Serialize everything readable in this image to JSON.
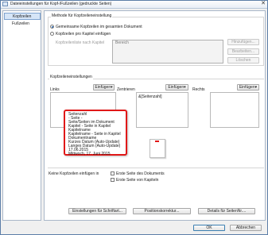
{
  "window": {
    "title": "Dateieinstellungen für Kopf-/Fußzeilen (gedruckte Seiten)",
    "close_glyph": "✕",
    "icon": "app-icon"
  },
  "sidebar": {
    "items": [
      {
        "label": "Kopfzeilen",
        "active": true
      },
      {
        "label": "Fußzeilen",
        "active": false
      }
    ]
  },
  "method": {
    "group_label": "Methode für Kopfzeileneinstellung",
    "option_document": "Gemeinsame Kopfzeilen im gesamten Dokument",
    "option_chapter": "Kopfzeilen pro Kapitel einfügen",
    "chapter_list_label": "Kopfzeilenliste nach Kapitel",
    "range_placeholder": "Bereich",
    "add_button": "Hinzufügen...",
    "edit_button": "Bearbeiten...",
    "delete_button": "Löschen"
  },
  "header_settings": {
    "group_label": "Kopfzeileneinstellungen",
    "left_label": "Links",
    "center_label": "Zentrieren",
    "right_label": "Rechts",
    "insert_button": "Einfügen",
    "dropdown_glyph": "▾",
    "center_value": "&[Seitenzahl]"
  },
  "insert_menu": {
    "items": [
      "Seitenzahl",
      "- Seite -",
      "Seite/Seiten im Dokument",
      "Kapitel - Seite in Kapitel",
      "Kapitelname",
      "Kapitelname - Seite in Kapitel",
      "Dokumentname",
      "Kurzes Datum (Auto-Update)",
      "Langes Datum (Auto-Update)",
      "17.06.2015",
      "Mittwoch, 17. Juni 2015"
    ]
  },
  "exclude": {
    "label": "Keine Kopfzeilen einfügen in",
    "first_doc_page": "Erste Seite des Dokuments",
    "first_chapter_page": "Erste Seite von Kapiteln"
  },
  "bottom_buttons": {
    "font": "Einstellungen für Schriftart...",
    "position": "Positionskorrektur...",
    "details": "Details für SeitenNr...."
  },
  "dialog_buttons": {
    "ok": "OK",
    "cancel": "Abbrechen"
  },
  "colors": {
    "highlight_border": "#e01818",
    "accent": "#1b5fb0",
    "preview_mark": "#e01818"
  }
}
